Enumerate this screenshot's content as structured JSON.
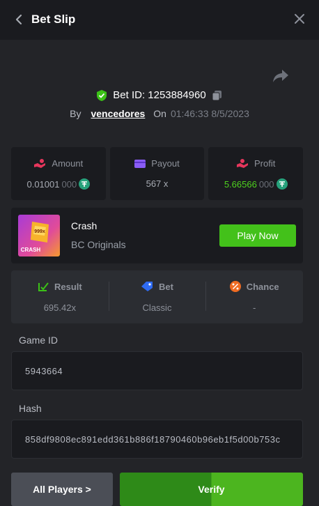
{
  "header": {
    "title": "Bet Slip"
  },
  "bet": {
    "id_label": "Bet ID: 1253884960",
    "by_label": "By",
    "user": "vencedores",
    "on_label": "On",
    "datetime": "01:46:33 8/5/2023"
  },
  "stats": {
    "amount": {
      "label": "Amount",
      "value_main": "0.01001",
      "value_dim": "000",
      "icon": "hand-coin-icon"
    },
    "payout": {
      "label": "Payout",
      "value": "567 x",
      "icon": "wallet-icon"
    },
    "profit": {
      "label": "Profit",
      "value_main": "5.66566",
      "value_dim": "000",
      "icon": "profit-icon"
    }
  },
  "game": {
    "name": "Crash",
    "provider": "BC Originals",
    "thumb_text": "CRASH",
    "thumb_badge": "999x",
    "play_label": "Play Now"
  },
  "result": {
    "result": {
      "label": "Result",
      "value": "695.42x"
    },
    "bet": {
      "label": "Bet",
      "value": "Classic"
    },
    "chance": {
      "label": "Chance",
      "value": "-"
    }
  },
  "fields": {
    "game_id_label": "Game ID",
    "game_id": "5943664",
    "hash_label": "Hash",
    "hash": "858df9808ec891edd361b886f18790460b96eb1f5d00b753c"
  },
  "actions": {
    "all_players": "All Players >",
    "verify": "Verify"
  },
  "colors": {
    "accent_green": "#43c11a",
    "profit_green": "#4ed11f",
    "coin": "#26a17b",
    "bg": "#232428",
    "panel": "#1a1b1f"
  }
}
